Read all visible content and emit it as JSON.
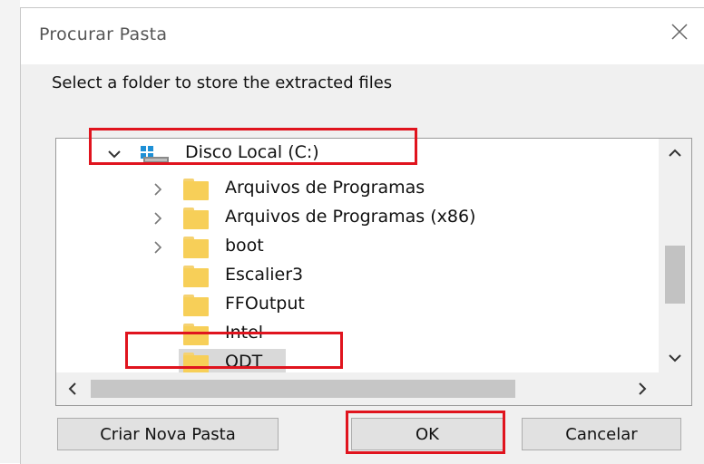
{
  "dialog": {
    "title": "Procurar Pasta",
    "instruction": "Select a folder to store the extracted files"
  },
  "tree": {
    "root": {
      "label": "Disco Local (C:)",
      "icon": "drive-icon",
      "expanded": true
    },
    "items": [
      {
        "label": "Arquivos de Programas",
        "expandable": true
      },
      {
        "label": "Arquivos de Programas (x86)",
        "expandable": true
      },
      {
        "label": "boot",
        "expandable": true
      },
      {
        "label": "Escalier3",
        "expandable": false
      },
      {
        "label": "FFOutput",
        "expandable": false
      },
      {
        "label": "Intel",
        "expandable": false
      },
      {
        "label": "ODT",
        "expandable": false,
        "selected": true
      }
    ]
  },
  "buttons": {
    "new_folder": "Criar Nova Pasta",
    "ok": "OK",
    "cancel": "Cancelar"
  },
  "colors": {
    "highlight": "#e0141e",
    "folder": "#f7cf58",
    "selection": "#d9d9d9"
  }
}
